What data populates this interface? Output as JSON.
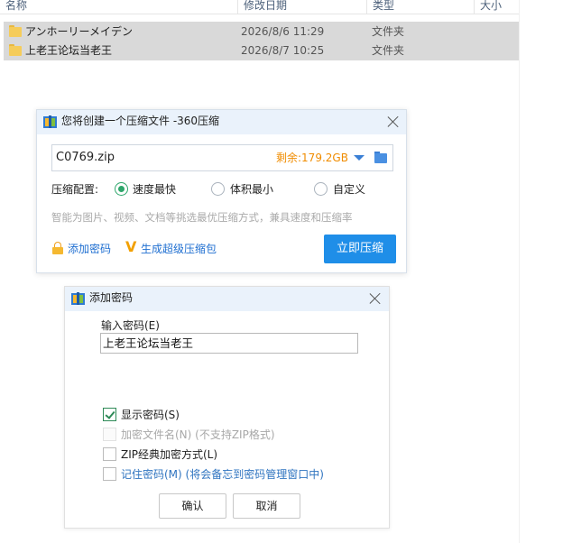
{
  "explorer": {
    "columns": [
      "名称",
      "修改日期",
      "类型",
      "大小"
    ],
    "rows": [
      {
        "name": "アンホーリーメイデン",
        "date": "2026/8/6 11:29",
        "type": "文件夹"
      },
      {
        "name": "上老王论坛当老王",
        "date": "2026/8/7 10:25",
        "type": "文件夹"
      }
    ]
  },
  "zip_dialog": {
    "title": "您将创建一个压缩文件 -360压缩",
    "filename": "C0769.zip",
    "free_space": "剩余:179.2GB",
    "config_label": "压缩配置:",
    "options": [
      "速度最快",
      "体积最小",
      "自定义"
    ],
    "selected_option": "速度最快",
    "hint": "智能为图片、视频、文档等挑选最优压缩方式，兼具速度和压缩率",
    "add_password": "添加密码",
    "super_zip": "生成超级压缩包",
    "compress_button": "立即压缩",
    "colors": {
      "accent": "#1f8ee8",
      "free_space": "#f08c00",
      "radio_on": "#2ea66b"
    }
  },
  "password_dialog": {
    "title": "添加密码",
    "input_label": "输入密码(E)",
    "password_value": "上老王论坛当老王",
    "checkboxes": [
      {
        "label": "显示密码(S)",
        "checked": true,
        "disabled": false
      },
      {
        "label": "加密文件名(N) (不支持ZIP格式)",
        "checked": false,
        "disabled": true
      },
      {
        "label": "ZIP经典加密方式(L)",
        "checked": false,
        "disabled": false
      },
      {
        "label": "记住密码(M) (将会备忘到密码管理窗口中)",
        "checked": false,
        "disabled": false
      }
    ],
    "ok_button": "确认",
    "cancel_button": "取消"
  }
}
